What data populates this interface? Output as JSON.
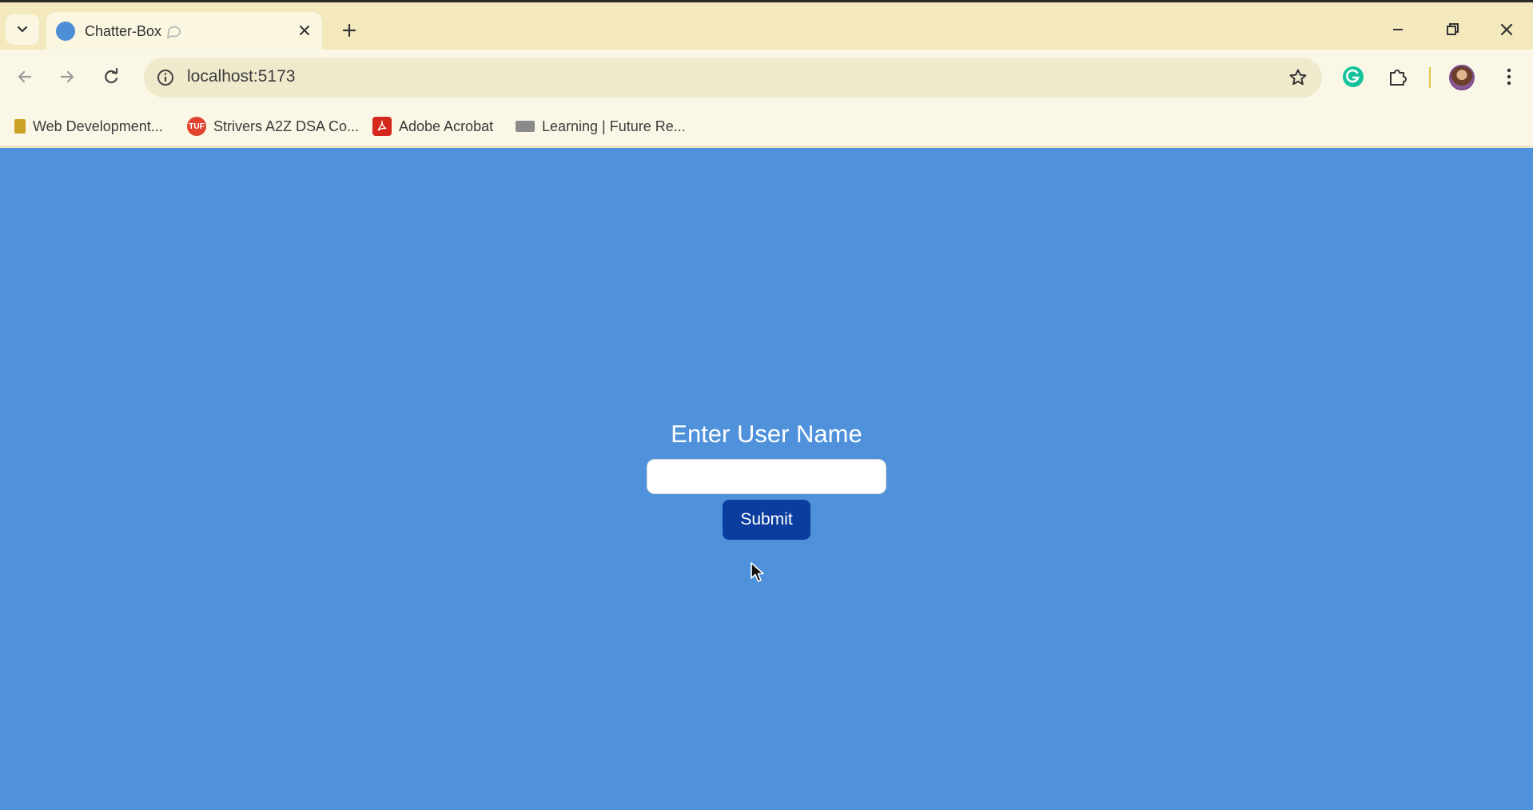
{
  "browser": {
    "tab": {
      "title": "Chatter-Box"
    },
    "address_bar": {
      "url": "localhost:5173"
    },
    "bookmarks": [
      {
        "label": "Web Development...",
        "icon": "folder-icon"
      },
      {
        "label": "Strivers A2Z DSA Co...",
        "icon": "tuf-icon"
      },
      {
        "label": "Adobe Acrobat",
        "icon": "acrobat-icon"
      },
      {
        "label": "Learning | Future Re...",
        "icon": "learning-icon"
      }
    ],
    "colors": {
      "chrome": "#f3e9bd",
      "toolbar": "#fbf7e6"
    }
  },
  "page": {
    "heading": "Enter User Name",
    "username_input": {
      "value": "",
      "placeholder": ""
    },
    "submit_label": "Submit",
    "colors": {
      "background": "#4f92db",
      "button": "#0b3d9e"
    }
  }
}
